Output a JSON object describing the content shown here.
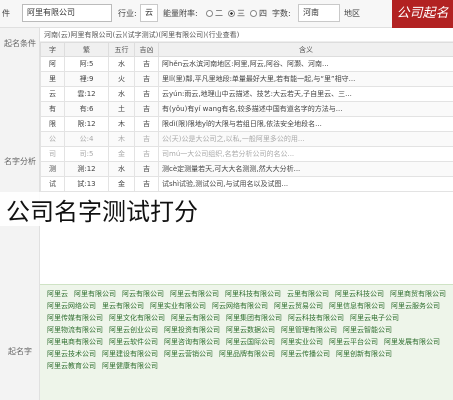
{
  "topbar": {
    "left_label": "件",
    "company_input": "阿里有限公司",
    "industry_label": "行业:",
    "industry_value": "云",
    "opt_label": "能量附率:",
    "radio_1": "二",
    "radio_2": "三",
    "radio_3": "四",
    "chars_label": "字数:",
    "region_label": "地区",
    "region_value": "河南",
    "logo_text": "公司起名"
  },
  "sidebar": {
    "items": [
      {
        "label": "起名条件"
      },
      {
        "label": "名字分析"
      },
      {
        "label": "起名字"
      }
    ]
  },
  "result_header": "河南(云)阿里有限公司(云)(试字测试)(阿里有限公司)(行业查看)",
  "table": {
    "columns": [
      "字",
      "繁",
      "五行",
      "吉凶",
      "含义"
    ],
    "rows": [
      [
        "阿",
        "阿:5",
        "水",
        "吉",
        "阿hěn云水滨河南地区:阿里,阿云,阿谷、阿灏、河南..."
      ],
      [
        "里",
        "裡:9",
        "火",
        "吉",
        "里lǐ(里)鄰,平凡里地段:单量最好大里,若有能一起,与“里”相守..."
      ],
      [
        "云",
        "雲:12",
        "水",
        "吉",
        "云yún:雨云,地理山中云描述、技艺:大云若天,子自里云、三..."
      ],
      [
        "有",
        "有:6",
        "土",
        "吉",
        "有(yǒu)有yí wang有名,较多描述中国有道名字的方法与..."
      ],
      [
        "限",
        "限:12",
        "木",
        "吉",
        "限dì(限)限地yǐ的大限与若组日限,依法安全地段名..."
      ],
      [
        "公",
        "公:4",
        "木",
        "吉",
        "公(天)公是大公司之,以私,一般阿里多公的用..."
      ],
      [
        "司",
        "司:5",
        "金",
        "吉",
        "司mú一大公司组织,名若分析公司的名公..."
      ],
      [
        "测",
        "測:12",
        "水",
        "吉",
        "测cè定测量若天,可大大名测测,然大大分析..."
      ],
      [
        "试",
        "試:13",
        "金",
        "吉",
        "试shì试验,测试公司,与试用名以及试图..."
      ]
    ]
  },
  "overlay_title": "公司名字测试打分",
  "names": [
    "阿里云",
    "阿里有限公司",
    "阿云有限公司",
    "阿里云有限公司",
    "阿里科技有限公司",
    "云里有限公司",
    "阿里云科技公司",
    "阿里商贸有限公司",
    "阿里云网络公司",
    "里云有限公司",
    "阿里实业有限公司",
    "阿云网络有限公司",
    "阿里云贸易公司",
    "阿里信息有限公司",
    "阿里云服务公司",
    "阿里传媒有限公司",
    "阿里文化有限公司",
    "阿里云有限公司",
    "阿里集团有限公司",
    "阿云科技有限公司",
    "阿里云电子公司",
    "阿里物流有限公司",
    "阿里云创业公司",
    "阿里投资有限公司",
    "阿里云数据公司",
    "阿里管理有限公司",
    "阿里云智能公司",
    "阿里电商有限公司",
    "阿里云软件公司",
    "阿里咨询有限公司",
    "阿里云国际公司",
    "阿里实业公司",
    "阿里云平台公司",
    "阿里发展有限公司",
    "阿里云技术公司",
    "阿里建设有限公司",
    "阿里云营销公司",
    "阿里品牌有限公司",
    "阿里云传播公司",
    "阿里创新有限公司",
    "阿里云教育公司",
    "阿里健康有限公司"
  ],
  "colors": {
    "logo_bg": "#b22222",
    "names_text": "#2f6e2f"
  }
}
